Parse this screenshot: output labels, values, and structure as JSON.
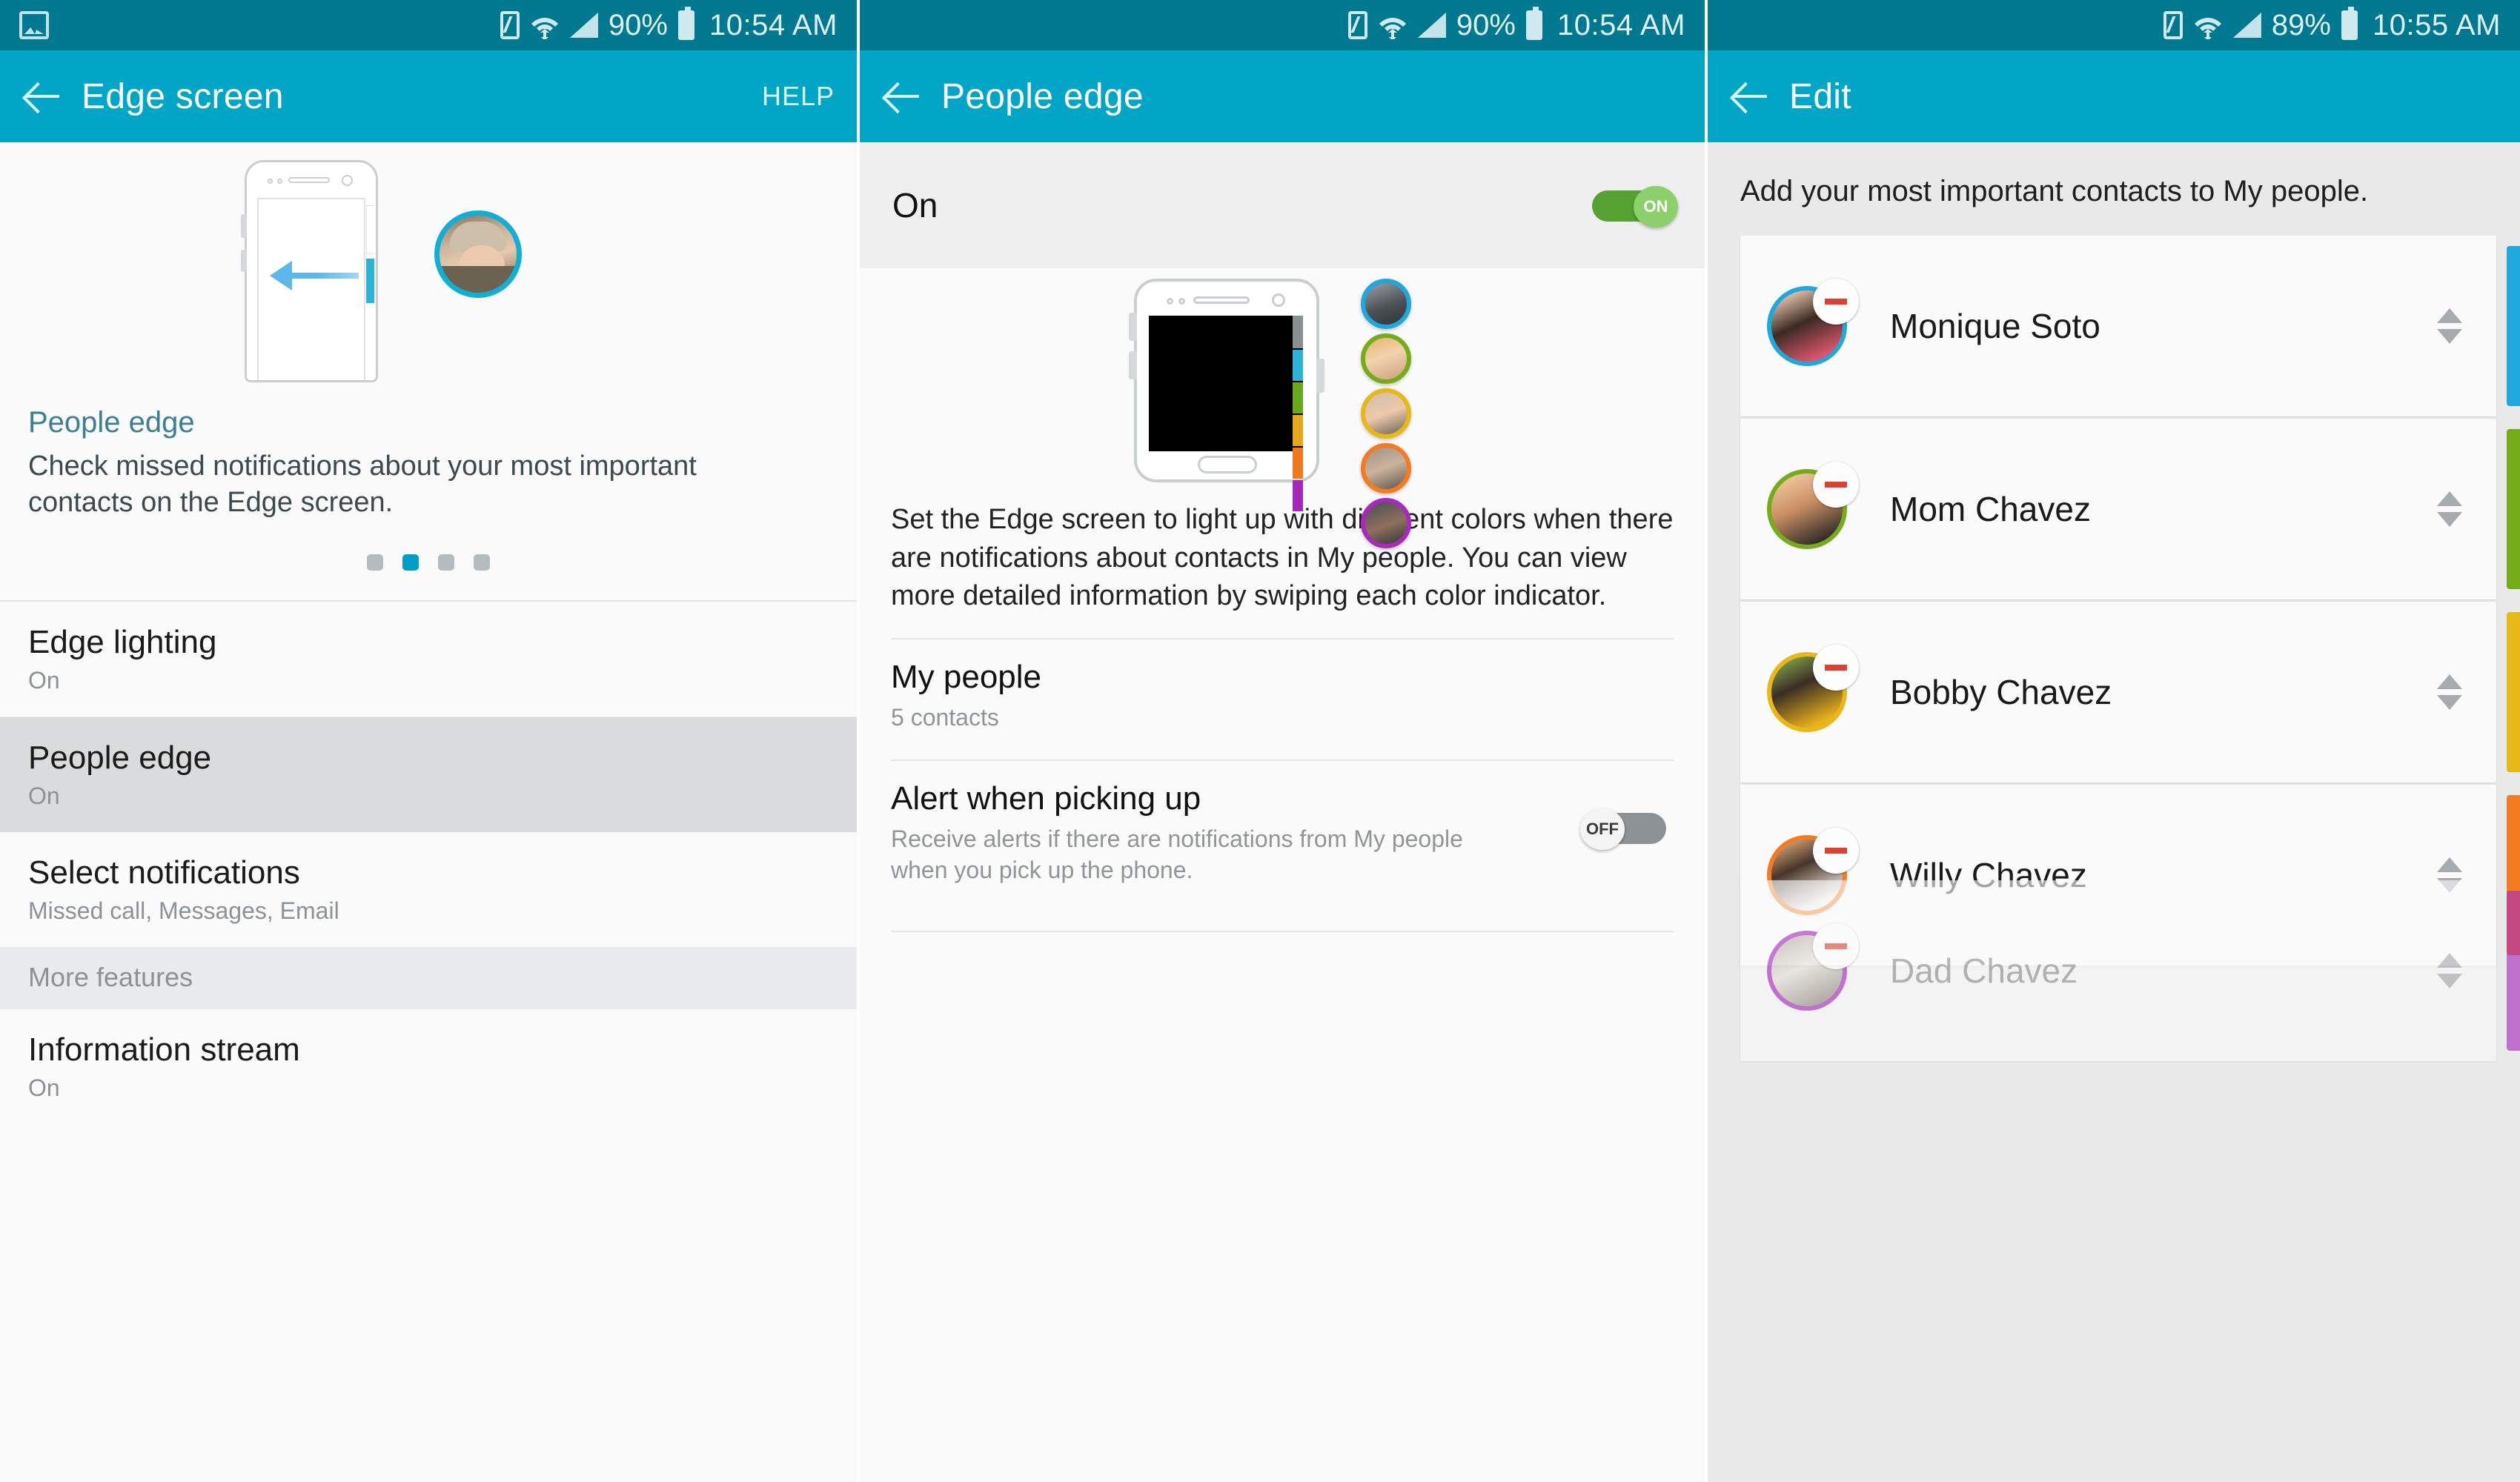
{
  "panel1": {
    "statusbar": {
      "battery_pct": "90%",
      "time": "10:54 AM",
      "icons": [
        "gallery-icon",
        "nfc-icon",
        "wifi-icon",
        "signal-icon",
        "battery-icon"
      ]
    },
    "appbar": {
      "title": "Edge screen",
      "help_label": "HELP",
      "back_icon": "back-arrow-icon"
    },
    "hero": {
      "illustration": "phone-edge-swipe-illustration",
      "avatar": "contact-avatar-photo"
    },
    "feature": {
      "title": "People edge",
      "description": "Check missed notifications about your most important contacts on the Edge screen."
    },
    "pager": {
      "count": 4,
      "active_index": 1
    },
    "list": [
      {
        "title": "Edge lighting",
        "sub": "On",
        "selected": false,
        "header": false
      },
      {
        "title": "People edge",
        "sub": "On",
        "selected": true,
        "header": false
      },
      {
        "title": "Select notifications",
        "sub": "Missed call, Messages, Email",
        "selected": false,
        "header": false
      },
      {
        "title": "More features",
        "sub": "",
        "selected": false,
        "header": true
      },
      {
        "title": "Information stream",
        "sub": "On",
        "selected": false,
        "header": false
      }
    ]
  },
  "panel2": {
    "statusbar": {
      "battery_pct": "90%",
      "time": "10:54 AM"
    },
    "appbar": {
      "title": "People edge",
      "back_icon": "back-arrow-icon"
    },
    "master_toggle": {
      "label": "On",
      "state": "ON",
      "state_label": "ON"
    },
    "illustration": {
      "name": "people-edge-phone-illustration",
      "edge_colors": [
        "#2cb3d6",
        "#6aa81c",
        "#e3a91a",
        "#f0781d",
        "#a229b8"
      ],
      "avatar_ring_colors": [
        "#1fa8dc",
        "#74ad18",
        "#e8b818",
        "#f47b20",
        "#a829bd"
      ]
    },
    "description": "Set the Edge screen to light up with different colors when there are notifications about contacts in My people. You can view more detailed information by swiping each color indicator.",
    "rows": [
      {
        "title": "My people",
        "sub": "5 contacts",
        "toggle": null
      },
      {
        "title": "Alert when picking up",
        "sub": "Receive alerts if there are notifications from My people when you pick up the phone.",
        "toggle": "OFF"
      }
    ]
  },
  "panel3": {
    "statusbar": {
      "battery_pct": "89%",
      "time": "10:55 AM"
    },
    "appbar": {
      "title": "Edit",
      "back_icon": "back-arrow-icon"
    },
    "intro": "Add your most important contacts to My people.",
    "contacts": [
      {
        "name": "Monique Soto",
        "ring_color": "#1fa8dc",
        "strip_color": "#1fa8dc",
        "ghost": false,
        "remove_icon": "minus-badge-icon",
        "reorder_icon": "reorder-updown-icon"
      },
      {
        "name": "Mom Chavez",
        "ring_color": "#74ad18",
        "strip_color": "#74ad18",
        "ghost": false,
        "remove_icon": "minus-badge-icon",
        "reorder_icon": "reorder-updown-icon"
      },
      {
        "name": "Bobby Chavez",
        "ring_color": "#e8b818",
        "strip_color": "#e8b818",
        "ghost": false,
        "remove_icon": "minus-badge-icon",
        "reorder_icon": "reorder-updown-icon"
      },
      {
        "name": "Willy Chavez",
        "ring_color": "#f47b20",
        "strip_color": "#f47b20",
        "ghost": false,
        "remove_icon": "minus-badge-icon",
        "reorder_icon": "reorder-updown-icon"
      },
      {
        "name": "Dad Chavez",
        "ring_color": "#a829bd",
        "strip_color": "#a829bd",
        "ghost": true,
        "remove_icon": "minus-badge-icon",
        "reorder_icon": "reorder-updown-icon"
      }
    ]
  },
  "theme": {
    "status_bar": "#00788f",
    "app_bar": "#01a6c7",
    "accent": "#00a0c6",
    "toggle_on": "#8bd06a",
    "remove_red": "#e0412f"
  }
}
